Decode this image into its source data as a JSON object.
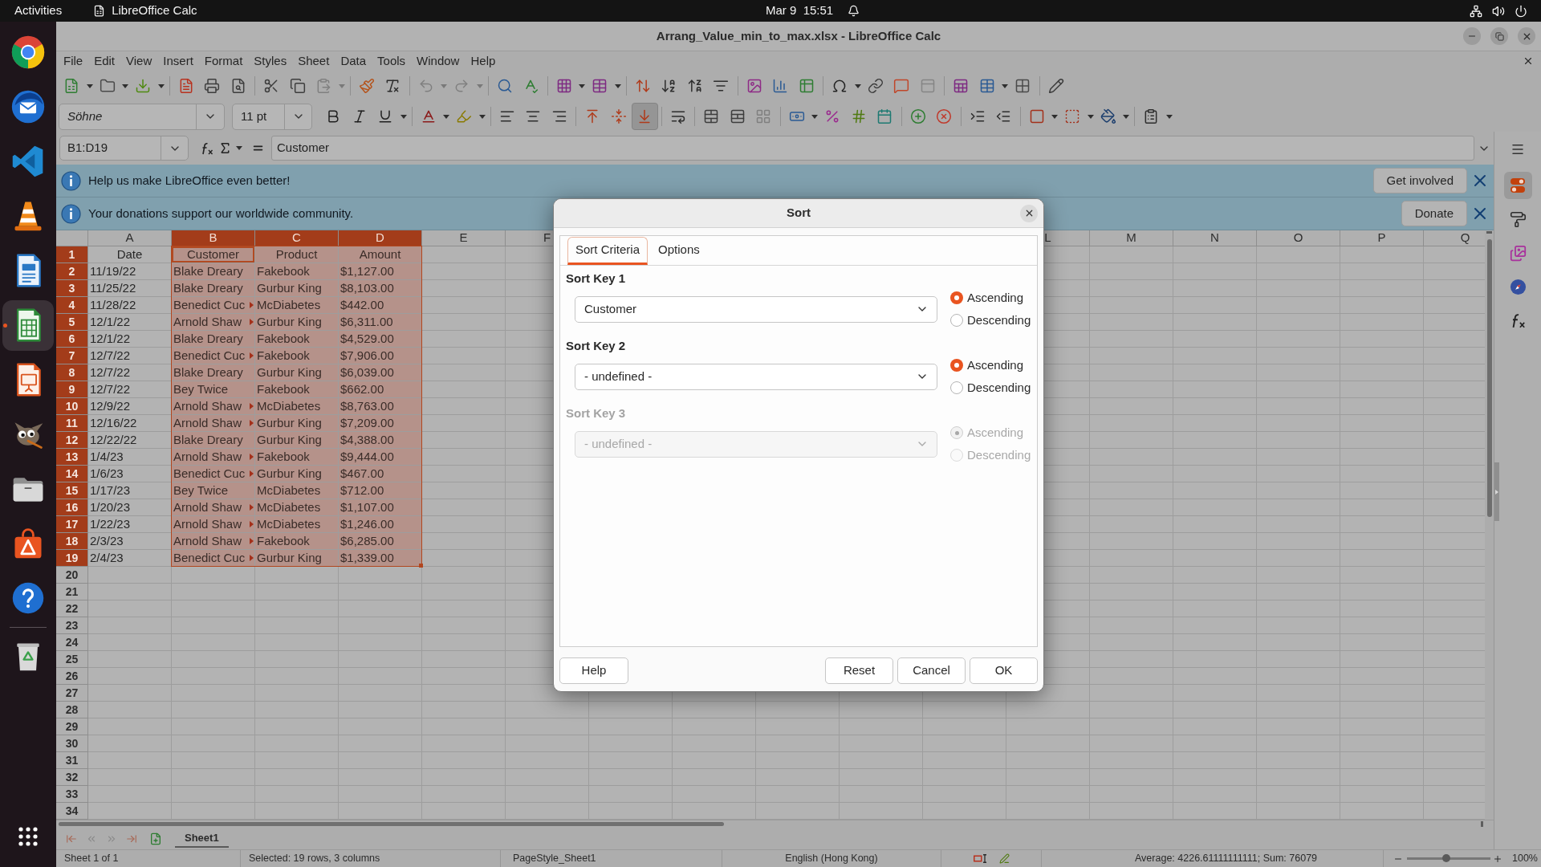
{
  "top_bar": {
    "activities": "Activities",
    "app_name": "LibreOffice Calc",
    "clock": "Mar 9  15:51"
  },
  "dock": {
    "items": [
      {
        "selected": false,
        "running": false
      },
      {
        "selected": false,
        "running": false
      },
      {
        "selected": false,
        "running": false
      },
      {
        "selected": false,
        "running": false
      },
      {
        "selected": false,
        "running": false
      },
      {
        "selected": true,
        "running": true
      },
      {
        "selected": false,
        "running": false
      },
      {
        "selected": false,
        "running": false
      },
      {
        "selected": false,
        "running": false
      },
      {
        "selected": false,
        "running": false
      },
      {
        "selected": false,
        "running": false
      },
      {
        "selected": false,
        "running": false
      }
    ]
  },
  "window": {
    "title": "Arrang_Value_min_to_max.xlsx - LibreOffice Calc",
    "menu": [
      "File",
      "Edit",
      "View",
      "Insert",
      "Format",
      "Styles",
      "Sheet",
      "Data",
      "Tools",
      "Window",
      "Help"
    ]
  },
  "standard_toolbar": {
    "buttons": [
      {
        "disabled": false
      },
      {
        "disabled": false
      },
      {
        "disabled": false
      },
      {
        "disabled": false
      },
      {
        "disabled": false
      },
      {
        "disabled": false
      },
      {
        "disabled": false
      },
      {
        "disabled": false
      },
      {
        "disabled": true
      },
      {
        "disabled": false
      },
      {
        "disabled": false
      },
      {
        "disabled": true
      },
      {
        "disabled": true
      },
      {
        "disabled": false
      },
      {
        "disabled": false
      },
      {
        "disabled": false
      },
      {
        "disabled": false
      },
      {
        "disabled": false
      },
      {
        "disabled": false
      },
      {
        "disabled": false
      },
      {
        "disabled": false
      },
      {
        "disabled": false
      },
      {
        "disabled": false
      },
      {
        "disabled": false
      },
      {
        "disabled": false
      },
      {
        "disabled": false
      },
      {
        "disabled": false
      },
      {
        "disabled": true
      },
      {
        "disabled": false
      },
      {
        "disabled": false
      },
      {
        "disabled": false
      },
      {
        "disabled": false
      }
    ]
  },
  "formatting_toolbar": {
    "font_name": "Söhne",
    "font_size": "11 pt",
    "buttons": [
      {
        "disabled": false,
        "pressed": false
      },
      {
        "disabled": false,
        "pressed": false
      },
      {
        "disabled": false,
        "pressed": false
      },
      {
        "disabled": false,
        "pressed": false
      },
      {
        "disabled": false,
        "pressed": false
      },
      {
        "disabled": false,
        "pressed": false
      },
      {
        "disabled": false,
        "pressed": false
      },
      {
        "disabled": false,
        "pressed": false
      },
      {
        "disabled": false,
        "pressed": false
      },
      {
        "disabled": false,
        "pressed": false
      },
      {
        "disabled": false,
        "pressed": true
      },
      {
        "disabled": false,
        "pressed": false
      },
      {
        "disabled": false,
        "pressed": false
      },
      {
        "disabled": false,
        "pressed": false
      },
      {
        "disabled": true,
        "pressed": false
      },
      {
        "disabled": false,
        "pressed": false
      },
      {
        "disabled": false,
        "pressed": false
      },
      {
        "disabled": false,
        "pressed": false
      },
      {
        "disabled": false,
        "pressed": false
      },
      {
        "disabled": false,
        "pressed": false
      },
      {
        "disabled": false,
        "pressed": false
      },
      {
        "disabled": false,
        "pressed": false
      },
      {
        "disabled": false,
        "pressed": false
      },
      {
        "disabled": false,
        "pressed": false
      },
      {
        "disabled": false,
        "pressed": false
      },
      {
        "disabled": false,
        "pressed": false
      },
      {
        "disabled": false,
        "pressed": false
      }
    ]
  },
  "formula_bar": {
    "name_box": "B1:D19",
    "content": "Customer"
  },
  "infobars": [
    {
      "message": "Help us make LibreOffice even better!",
      "action": "Get involved"
    },
    {
      "message": "Your donations support our worldwide community.",
      "action": "Donate"
    }
  ],
  "spreadsheet": {
    "columns_left": [
      {
        "label": "A",
        "selected": false
      },
      {
        "label": "B",
        "selected": true
      },
      {
        "label": "C",
        "selected": true
      },
      {
        "label": "D",
        "selected": true
      },
      {
        "label": "E",
        "selected": false
      },
      {
        "label": "F",
        "selected": false
      }
    ],
    "columns_right": [
      {
        "label": "L",
        "selected": false
      },
      {
        "label": "M",
        "selected": false
      },
      {
        "label": "N",
        "selected": false
      },
      {
        "label": "O",
        "selected": false
      },
      {
        "label": "P",
        "selected": false
      },
      {
        "label": "Q",
        "selected": false
      }
    ],
    "rows": [
      {
        "number": "1",
        "kind": "header",
        "selected": true,
        "cells": [
          {
            "text": "Date",
            "clipped": false,
            "cursor": false
          },
          {
            "text": "Customer",
            "clipped": false,
            "cursor": true
          },
          {
            "text": "Product",
            "clipped": false,
            "cursor": false
          },
          {
            "text": "Amount",
            "clipped": false,
            "cursor": false
          }
        ]
      },
      {
        "number": "2",
        "kind": "data",
        "selected": true,
        "cells": [
          {
            "text": "11/19/22",
            "clipped": false,
            "cursor": false
          },
          {
            "text": "Blake Dreary",
            "clipped": false,
            "cursor": false
          },
          {
            "text": "Fakebook",
            "clipped": false,
            "cursor": false
          },
          {
            "text": "$1,127.00",
            "clipped": false,
            "cursor": false
          }
        ]
      },
      {
        "number": "3",
        "kind": "data",
        "selected": true,
        "cells": [
          {
            "text": "11/25/22",
            "clipped": false,
            "cursor": false
          },
          {
            "text": "Blake Dreary",
            "clipped": false,
            "cursor": false
          },
          {
            "text": "Gurbur King",
            "clipped": false,
            "cursor": false
          },
          {
            "text": "$8,103.00",
            "clipped": false,
            "cursor": false
          }
        ]
      },
      {
        "number": "4",
        "kind": "data",
        "selected": true,
        "cells": [
          {
            "text": "11/28/22",
            "clipped": false,
            "cursor": false
          },
          {
            "text": "Benedict Cuc",
            "clipped": true,
            "cursor": false
          },
          {
            "text": "McDiabetes",
            "clipped": false,
            "cursor": false
          },
          {
            "text": "$442.00",
            "clipped": false,
            "cursor": false
          }
        ]
      },
      {
        "number": "5",
        "kind": "data",
        "selected": true,
        "cells": [
          {
            "text": "12/1/22",
            "clipped": false,
            "cursor": false
          },
          {
            "text": "Arnold Shaw",
            "clipped": true,
            "cursor": false
          },
          {
            "text": "Gurbur King",
            "clipped": false,
            "cursor": false
          },
          {
            "text": "$6,311.00",
            "clipped": false,
            "cursor": false
          }
        ]
      },
      {
        "number": "6",
        "kind": "data",
        "selected": true,
        "cells": [
          {
            "text": "12/1/22",
            "clipped": false,
            "cursor": false
          },
          {
            "text": "Blake Dreary",
            "clipped": false,
            "cursor": false
          },
          {
            "text": "Fakebook",
            "clipped": false,
            "cursor": false
          },
          {
            "text": "$4,529.00",
            "clipped": false,
            "cursor": false
          }
        ]
      },
      {
        "number": "7",
        "kind": "data",
        "selected": true,
        "cells": [
          {
            "text": "12/7/22",
            "clipped": false,
            "cursor": false
          },
          {
            "text": "Benedict Cuc",
            "clipped": true,
            "cursor": false
          },
          {
            "text": "Fakebook",
            "clipped": false,
            "cursor": false
          },
          {
            "text": "$7,906.00",
            "clipped": false,
            "cursor": false
          }
        ]
      },
      {
        "number": "8",
        "kind": "data",
        "selected": true,
        "cells": [
          {
            "text": "12/7/22",
            "clipped": false,
            "cursor": false
          },
          {
            "text": "Blake Dreary",
            "clipped": false,
            "cursor": false
          },
          {
            "text": "Gurbur King",
            "clipped": false,
            "cursor": false
          },
          {
            "text": "$6,039.00",
            "clipped": false,
            "cursor": false
          }
        ]
      },
      {
        "number": "9",
        "kind": "data",
        "selected": true,
        "cells": [
          {
            "text": "12/7/22",
            "clipped": false,
            "cursor": false
          },
          {
            "text": "Bey Twice",
            "clipped": false,
            "cursor": false
          },
          {
            "text": "Fakebook",
            "clipped": false,
            "cursor": false
          },
          {
            "text": "$662.00",
            "clipped": false,
            "cursor": false
          }
        ]
      },
      {
        "number": "10",
        "kind": "data",
        "selected": true,
        "cells": [
          {
            "text": "12/9/22",
            "clipped": false,
            "cursor": false
          },
          {
            "text": "Arnold Shaw",
            "clipped": true,
            "cursor": false
          },
          {
            "text": "McDiabetes",
            "clipped": false,
            "cursor": false
          },
          {
            "text": "$8,763.00",
            "clipped": false,
            "cursor": false
          }
        ]
      },
      {
        "number": "11",
        "kind": "data",
        "selected": true,
        "cells": [
          {
            "text": "12/16/22",
            "clipped": false,
            "cursor": false
          },
          {
            "text": "Arnold Shaw",
            "clipped": true,
            "cursor": false
          },
          {
            "text": "Gurbur King",
            "clipped": false,
            "cursor": false
          },
          {
            "text": "$7,209.00",
            "clipped": false,
            "cursor": false
          }
        ]
      },
      {
        "number": "12",
        "kind": "data",
        "selected": true,
        "cells": [
          {
            "text": "12/22/22",
            "clipped": false,
            "cursor": false
          },
          {
            "text": "Blake Dreary",
            "clipped": false,
            "cursor": false
          },
          {
            "text": "Gurbur King",
            "clipped": false,
            "cursor": false
          },
          {
            "text": "$4,388.00",
            "clipped": false,
            "cursor": false
          }
        ]
      },
      {
        "number": "13",
        "kind": "data",
        "selected": true,
        "cells": [
          {
            "text": "1/4/23",
            "clipped": false,
            "cursor": false
          },
          {
            "text": "Arnold Shaw",
            "clipped": true,
            "cursor": false
          },
          {
            "text": "Fakebook",
            "clipped": false,
            "cursor": false
          },
          {
            "text": "$9,444.00",
            "clipped": false,
            "cursor": false
          }
        ]
      },
      {
        "number": "14",
        "kind": "data",
        "selected": true,
        "cells": [
          {
            "text": "1/6/23",
            "clipped": false,
            "cursor": false
          },
          {
            "text": "Benedict Cuc",
            "clipped": true,
            "cursor": false
          },
          {
            "text": "Gurbur King",
            "clipped": false,
            "cursor": false
          },
          {
            "text": "$467.00",
            "clipped": false,
            "cursor": false
          }
        ]
      },
      {
        "number": "15",
        "kind": "data",
        "selected": true,
        "cells": [
          {
            "text": "1/17/23",
            "clipped": false,
            "cursor": false
          },
          {
            "text": "Bey Twice",
            "clipped": false,
            "cursor": false
          },
          {
            "text": "McDiabetes",
            "clipped": false,
            "cursor": false
          },
          {
            "text": "$712.00",
            "clipped": false,
            "cursor": false
          }
        ]
      },
      {
        "number": "16",
        "kind": "data",
        "selected": true,
        "cells": [
          {
            "text": "1/20/23",
            "clipped": false,
            "cursor": false
          },
          {
            "text": "Arnold Shaw",
            "clipped": true,
            "cursor": false
          },
          {
            "text": "McDiabetes",
            "clipped": false,
            "cursor": false
          },
          {
            "text": "$1,107.00",
            "clipped": false,
            "cursor": false
          }
        ]
      },
      {
        "number": "17",
        "kind": "data",
        "selected": true,
        "cells": [
          {
            "text": "1/22/23",
            "clipped": false,
            "cursor": false
          },
          {
            "text": "Arnold Shaw",
            "clipped": true,
            "cursor": false
          },
          {
            "text": "McDiabetes",
            "clipped": false,
            "cursor": false
          },
          {
            "text": "$1,246.00",
            "clipped": false,
            "cursor": false
          }
        ]
      },
      {
        "number": "18",
        "kind": "data",
        "selected": true,
        "cells": [
          {
            "text": "2/3/23",
            "clipped": false,
            "cursor": false
          },
          {
            "text": "Arnold Shaw",
            "clipped": true,
            "cursor": false
          },
          {
            "text": "Fakebook",
            "clipped": false,
            "cursor": false
          },
          {
            "text": "$6,285.00",
            "clipped": false,
            "cursor": false
          }
        ]
      },
      {
        "number": "19",
        "kind": "data",
        "selected": true,
        "cells": [
          {
            "text": "2/4/23",
            "clipped": false,
            "cursor": false
          },
          {
            "text": "Benedict Cuc",
            "clipped": true,
            "cursor": false
          },
          {
            "text": "Gurbur King",
            "clipped": false,
            "cursor": false
          },
          {
            "text": "$1,339.00",
            "clipped": false,
            "cursor": false
          }
        ]
      },
      {
        "number": "20",
        "selected": false
      },
      {
        "number": "21",
        "selected": false
      },
      {
        "number": "22",
        "selected": false
      },
      {
        "number": "23",
        "selected": false
      },
      {
        "number": "24",
        "selected": false
      },
      {
        "number": "25",
        "selected": false
      },
      {
        "number": "26",
        "selected": false
      },
      {
        "number": "27",
        "selected": false
      },
      {
        "number": "28",
        "selected": false
      },
      {
        "number": "29",
        "selected": false
      },
      {
        "number": "30",
        "selected": false
      },
      {
        "number": "31",
        "selected": false
      },
      {
        "number": "32",
        "selected": false
      },
      {
        "number": "33",
        "selected": false
      },
      {
        "number": "34",
        "selected": false
      }
    ]
  },
  "sheet_tabs": [
    {
      "label": "Sheet1",
      "selected": true
    }
  ],
  "status_bar": {
    "sheet": "Sheet 1 of 1",
    "selection": "Selected: 19 rows, 3 columns",
    "page_style": "PageStyle_Sheet1",
    "language": "English (Hong Kong)",
    "summary": "Average: 4226.61111111111; Sum: 76079",
    "zoom": {
      "level": 0.47,
      "reading": "100%"
    }
  },
  "sidebar": {
    "tabs": [
      {
        "selected": true
      },
      {
        "selected": false
      },
      {
        "selected": false
      },
      {
        "selected": false
      },
      {
        "selected": false
      }
    ]
  },
  "sort_dialog": {
    "title": "Sort",
    "tabs": [
      {
        "label": "Sort Criteria",
        "selected": true
      },
      {
        "label": "Options",
        "selected": false
      }
    ],
    "keys": [
      {
        "label": "Sort Key 1",
        "value": "Customer",
        "disabled": false,
        "orders": [
          {
            "label": "Ascending",
            "selected": true
          },
          {
            "label": "Descending",
            "selected": false
          }
        ]
      },
      {
        "label": "Sort Key 2",
        "value": "- undefined -",
        "disabled": false,
        "orders": [
          {
            "label": "Ascending",
            "selected": true
          },
          {
            "label": "Descending",
            "selected": false
          }
        ]
      },
      {
        "label": "Sort Key 3",
        "value": "- undefined -",
        "disabled": true,
        "orders": [
          {
            "label": "Ascending",
            "selected": true
          },
          {
            "label": "Descending",
            "selected": false
          }
        ]
      }
    ],
    "help_button": "Help",
    "buttons": [
      "Reset",
      "Cancel",
      "OK"
    ]
  }
}
